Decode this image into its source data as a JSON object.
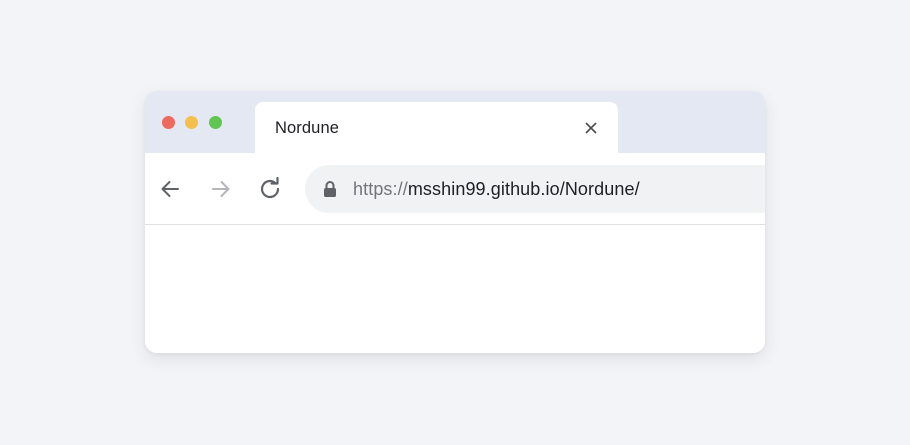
{
  "window": {
    "traffic_lights": {
      "close_color": "#ec6a5e",
      "minimize_color": "#f4bf4f",
      "maximize_color": "#61c554"
    }
  },
  "tab": {
    "title": "Nordune",
    "close_icon": "close-icon"
  },
  "toolbar": {
    "back_icon": "arrow-left-icon",
    "forward_icon": "arrow-right-icon",
    "reload_icon": "reload-icon",
    "back_color": "#5f6368",
    "forward_color": "#b4b6ba",
    "reload_color": "#5f6368"
  },
  "address_bar": {
    "lock_icon": "lock-icon",
    "scheme": "https://",
    "url_rest": "msshin99.github.io/Nordune/"
  },
  "colors": {
    "page_background": "#f3f4f8",
    "tab_strip": "#e4e8f3",
    "address_bar_background": "#f1f2f4"
  }
}
